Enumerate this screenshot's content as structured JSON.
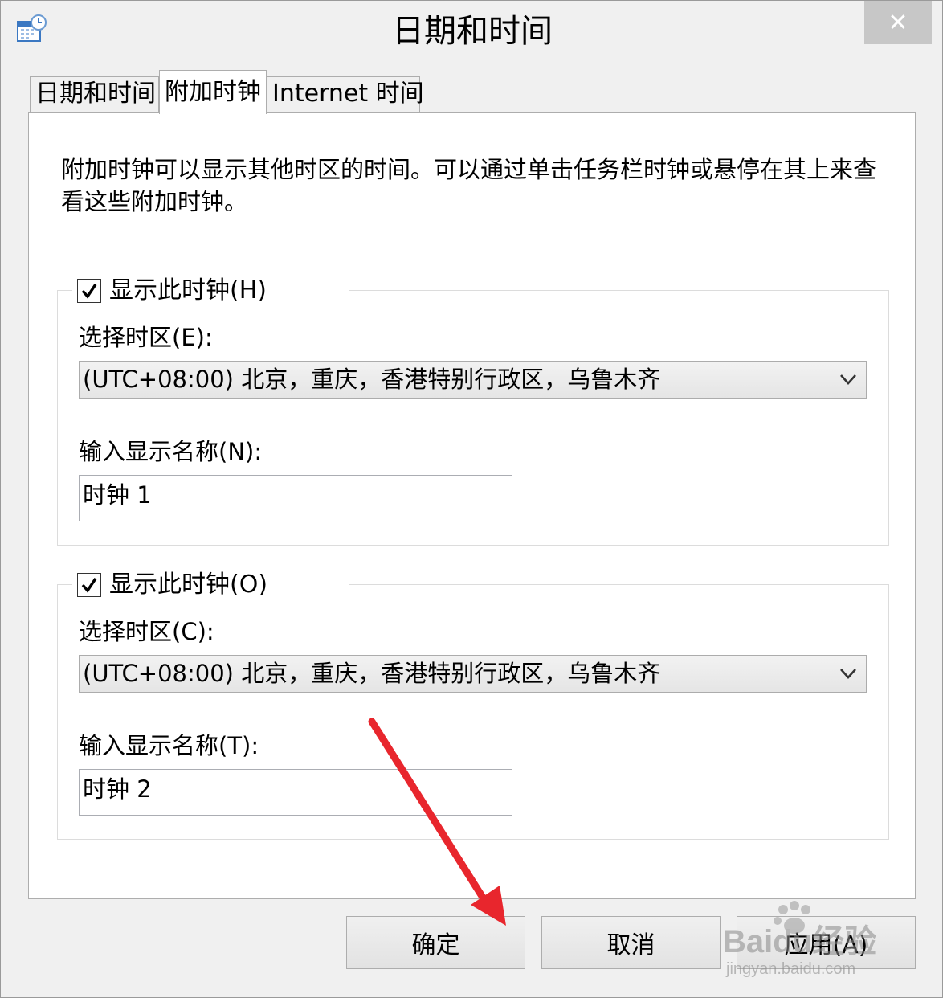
{
  "window": {
    "title": "日期和时间",
    "close_glyph": "✕",
    "accent_arrow_color": "#e8262d"
  },
  "tabs": [
    {
      "label": "日期和时间",
      "active": false
    },
    {
      "label": "附加时钟",
      "active": true
    },
    {
      "label": "Internet 时间",
      "active": false
    }
  ],
  "panel": {
    "intro": "附加时钟可以显示其他时区的时间。可以通过单击任务栏时钟或悬停在其上来查看这些附加时钟。"
  },
  "clocks": [
    {
      "show_label": "显示此时钟(H)",
      "checked": true,
      "timezone_label": "选择时区(E):",
      "timezone_value": "(UTC+08:00) 北京，重庆，香港特别行政区，乌鲁木齐",
      "name_label": "输入显示名称(N):",
      "name_value": "时钟 1"
    },
    {
      "show_label": "显示此时钟(O)",
      "checked": true,
      "timezone_label": "选择时区(C):",
      "timezone_value": "(UTC+08:00) 北京，重庆，香港特别行政区，乌鲁木齐",
      "name_label": "输入显示名称(T):",
      "name_value": "时钟 2"
    }
  ],
  "buttons": {
    "ok": "确定",
    "cancel": "取消",
    "apply": "应用(A)"
  },
  "watermark": {
    "brand": "Baidu经验",
    "url": "jingyan.baidu.com"
  }
}
